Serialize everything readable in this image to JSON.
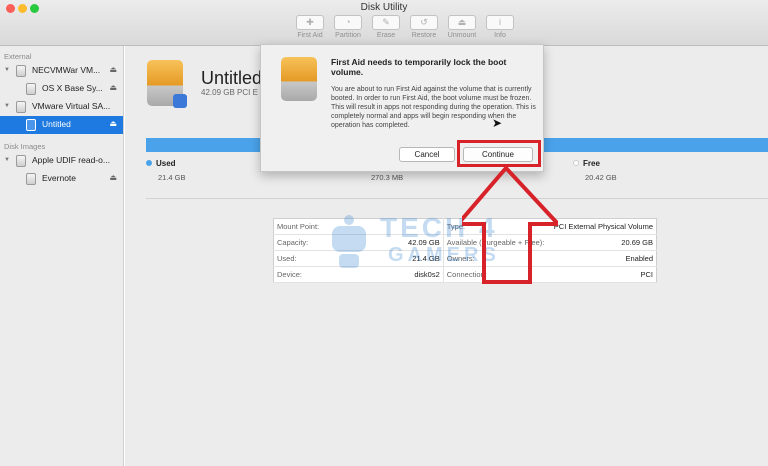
{
  "window": {
    "title": "Disk Utility"
  },
  "toolbar": {
    "items": [
      {
        "label": "First Aid",
        "icon": "stethoscope-icon"
      },
      {
        "label": "Partition",
        "icon": "partition-icon"
      },
      {
        "label": "Erase",
        "icon": "erase-icon"
      },
      {
        "label": "Restore",
        "icon": "restore-icon"
      },
      {
        "label": "Unmount",
        "icon": "unmount-icon"
      },
      {
        "label": "Info",
        "icon": "info-icon"
      }
    ]
  },
  "sidebar": {
    "external_header": "External",
    "disk_images_header": "Disk Images",
    "items": [
      {
        "label": "NECVMWar VM...",
        "eject": "⏏"
      },
      {
        "label": "OS X Base Sy...",
        "eject": "⏏"
      },
      {
        "label": "VMware Virtual SA..."
      },
      {
        "label": "Untitled",
        "eject": "⏏"
      },
      {
        "label": "Apple UDIF read-o..."
      },
      {
        "label": "Evernote",
        "eject": "⏏"
      }
    ]
  },
  "volume": {
    "name": "Untitled",
    "subtitle": "42.09 GB PCI E"
  },
  "usage": {
    "used_label": "Used",
    "used_value": "21.4 GB",
    "other_value": "270.3 MB",
    "free_label": "Free",
    "free_value": "20.42 GB",
    "used_color": "#4aa3ea"
  },
  "info": {
    "rows": [
      {
        "k": "Mount Point:",
        "v": "",
        "k2": "Type:",
        "v2": "PCI External Physical Volume"
      },
      {
        "k": "Capacity:",
        "v": "42.09 GB",
        "k2": "Available (Purgeable + Free):",
        "v2": "20.69 GB"
      },
      {
        "k": "Used:",
        "v": "21.4 GB",
        "k2": "Owners:",
        "v2": "Enabled"
      },
      {
        "k": "Device:",
        "v": "disk0s2",
        "k2": "Connection:",
        "v2": "PCI"
      }
    ]
  },
  "dialog": {
    "title": "First Aid needs to temporarily lock the boot volume.",
    "body": "You are about to run First Aid against the volume that is currently booted. In order to run First Aid, the boot volume must be frozen. This will result in apps not responding during the operation. This is completely normal and apps will begin responding when the operation has completed.",
    "cancel": "Cancel",
    "continue": "Continue"
  },
  "watermark": {
    "line1": "TECH 4",
    "line2": "GAMERS"
  },
  "colors": {
    "highlight": "#d72229",
    "selection": "#1e7ae0",
    "accent": "#4aa3ea"
  }
}
